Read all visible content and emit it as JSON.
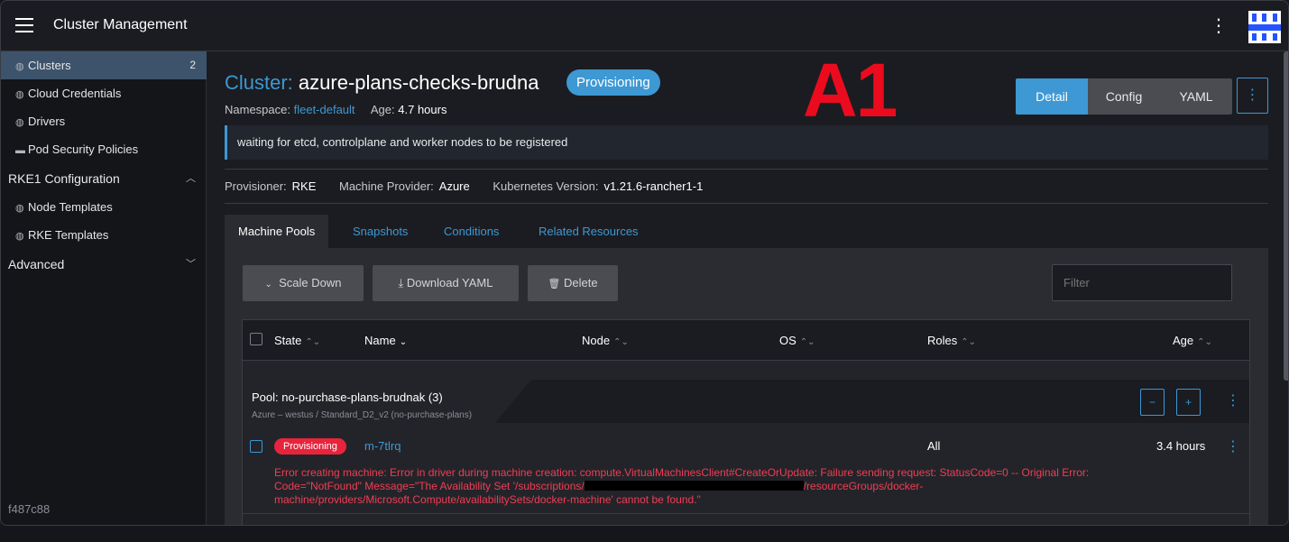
{
  "header": {
    "app_title": "Cluster Management",
    "menu_icon": "hamburger-icon",
    "overflow_icon": "kebab-icon",
    "logo_icon": "rancher-logo"
  },
  "sidebar": {
    "items": [
      {
        "label": "Clusters",
        "count": "2",
        "active": true,
        "icon": "globe-icon"
      },
      {
        "label": "Cloud Credentials",
        "icon": "globe-icon"
      },
      {
        "label": "Drivers",
        "icon": "globe-icon"
      },
      {
        "label": "Pod Security Policies",
        "icon": "folder-icon"
      }
    ],
    "group_rke1": "RKE1 Configuration",
    "rke1_items": [
      {
        "label": "Node Templates",
        "icon": "globe-icon"
      },
      {
        "label": "RKE Templates",
        "icon": "globe-icon"
      }
    ],
    "group_advanced": "Advanced",
    "commit": "f487c88"
  },
  "cluster": {
    "title_prefix": "Cluster:",
    "name": "azure-plans-checks-brudna",
    "state": "Provisioning",
    "namespace_label": "Namespace:",
    "namespace": "fleet-default",
    "age_label": "Age:",
    "age": "4.7 hours",
    "overlay_label": "A1",
    "banner": "waiting for etcd, controlplane and worker nodes to be registered",
    "provisioner_label": "Provisioner:",
    "provisioner": "RKE",
    "machine_provider_label": "Machine Provider:",
    "machine_provider": "Azure",
    "k8s_version_label": "Kubernetes Version:",
    "k8s_version": "v1.21.6-rancher1-1"
  },
  "view_toggle": {
    "detail": "Detail",
    "config": "Config",
    "yaml": "YAML",
    "active": "Detail"
  },
  "tabs": [
    {
      "label": "Machine Pools",
      "active": true
    },
    {
      "label": "Snapshots"
    },
    {
      "label": "Conditions"
    },
    {
      "label": "Related Resources"
    }
  ],
  "toolbar": {
    "scale_down": "Scale Down",
    "download_yaml": "Download YAML",
    "delete": "Delete",
    "filter_placeholder": "Filter"
  },
  "table": {
    "columns": [
      "State",
      "Name",
      "Node",
      "OS",
      "Roles",
      "Age"
    ],
    "pool": {
      "name": "Pool: no-purchase-plans-brudnak (3)",
      "subtitle": "Azure – westus / Standard_D2_v2 (no-purchase-plans)",
      "minus": "−",
      "plus": "+"
    },
    "rows": [
      {
        "state": "Provisioning",
        "name": "m-7tlrq",
        "node": "",
        "os": "",
        "roles": "All",
        "age": "3.4 hours",
        "error_part1": "Error creating machine: Error in driver during machine creation: compute.VirtualMachinesClient#CreateOrUpdate: Failure sending request: StatusCode=0 -- Original Error: Code=\"NotFound\" Message=\"The Availability Set '/subscriptions/",
        "error_part2": "/resourceGroups/docker-machine/providers/Microsoft.Compute/availabilitySets/docker-machine' cannot be found.\""
      }
    ]
  },
  "colors": {
    "accent": "#3d98d3",
    "error": "#e8243c",
    "overlay_red": "#ec0b1e",
    "background": "#1b1c21"
  }
}
